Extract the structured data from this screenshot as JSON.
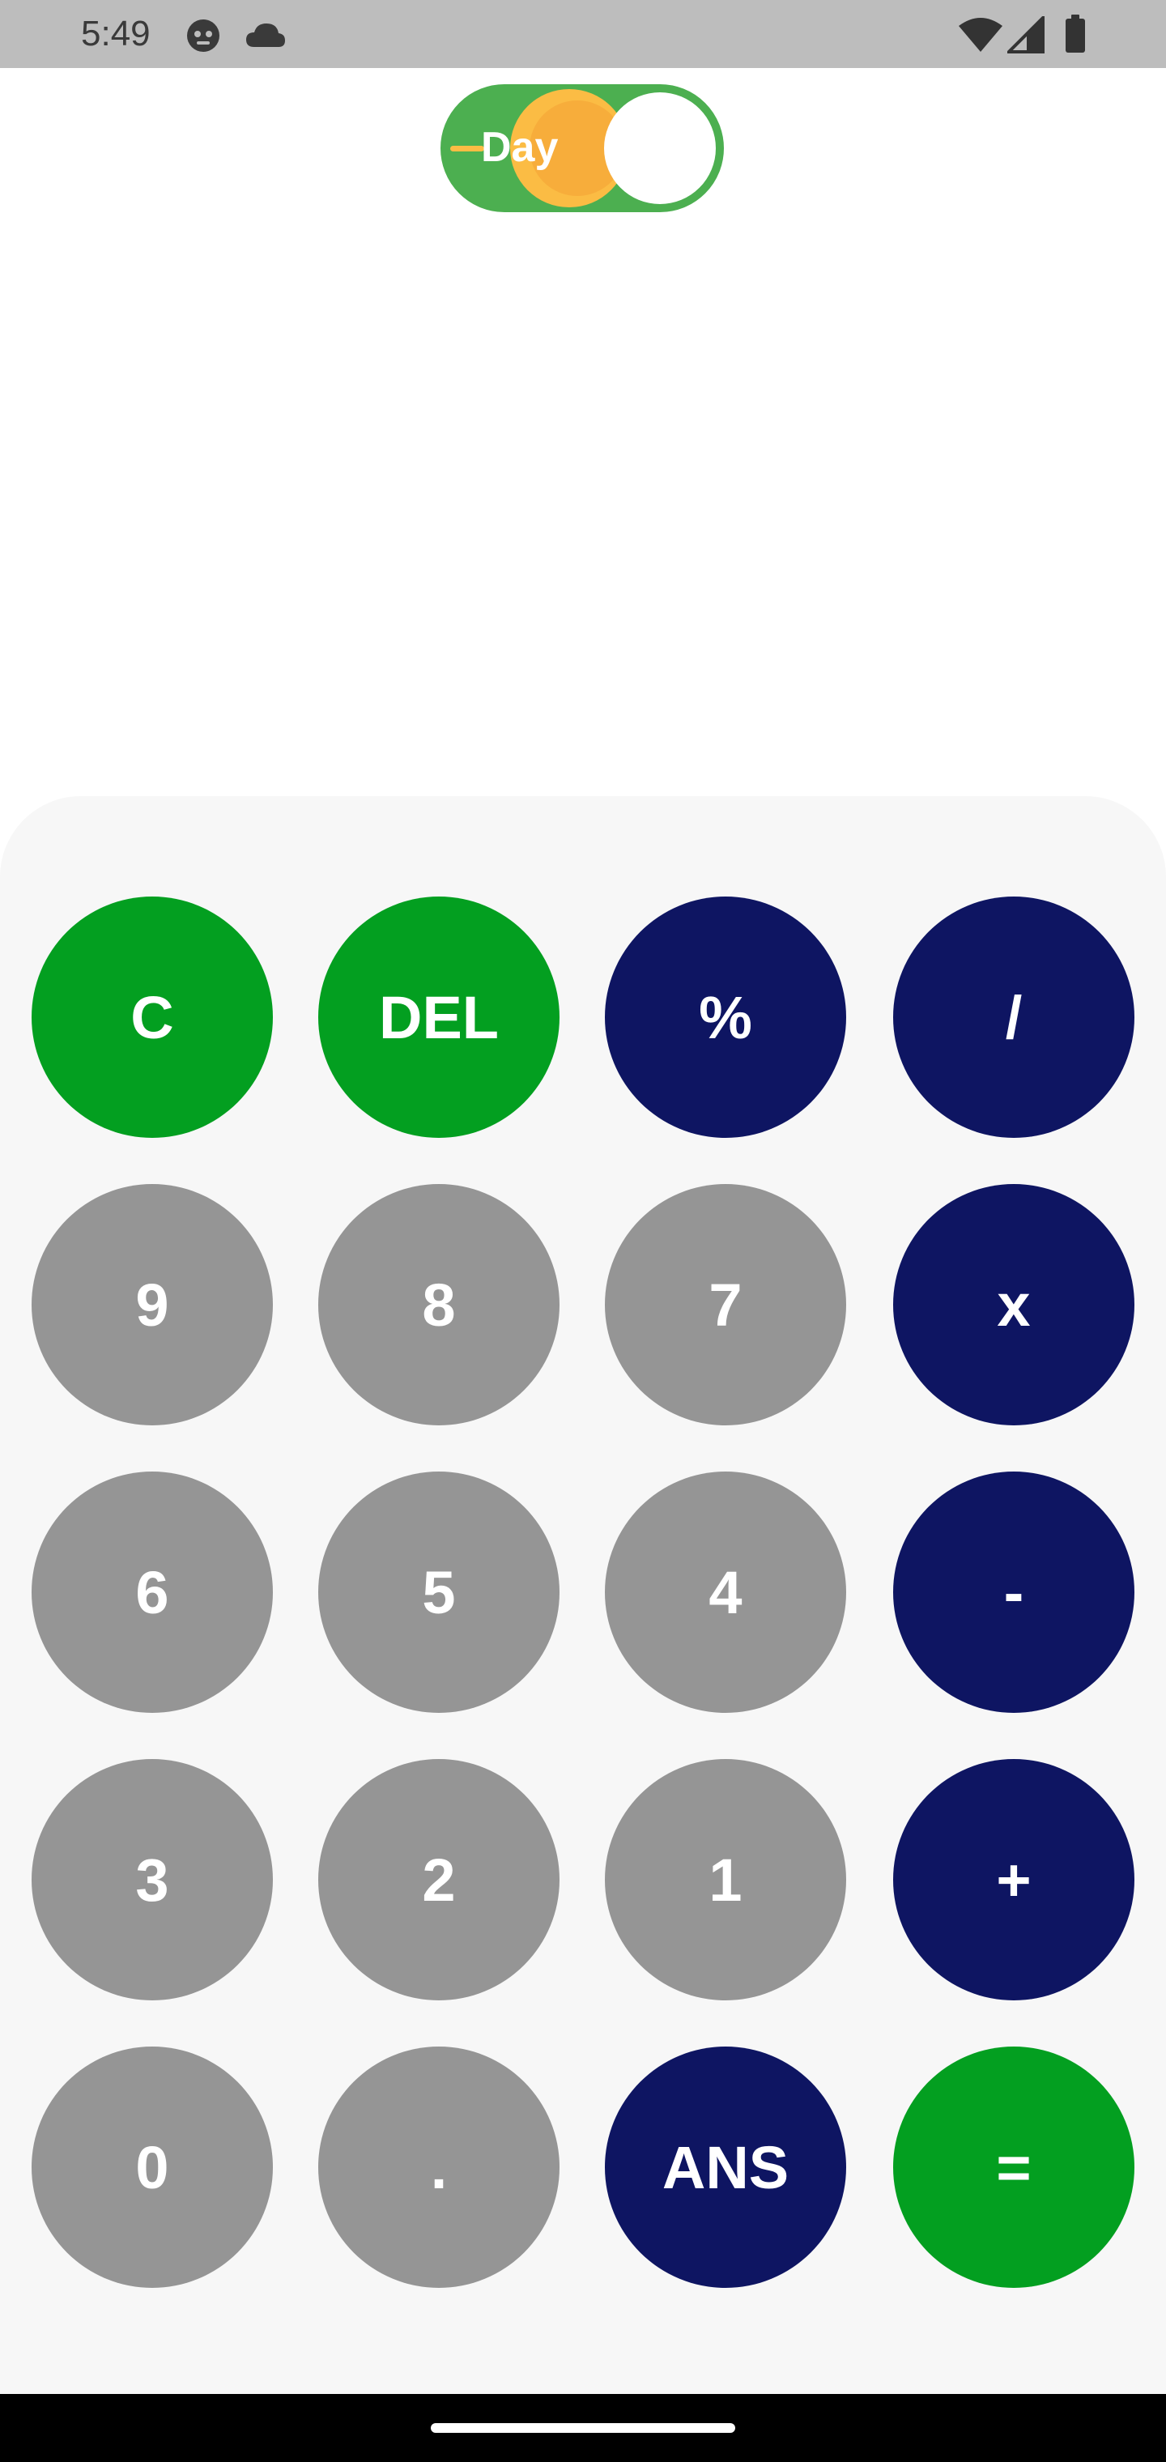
{
  "status_bar": {
    "time": "5:49",
    "icons": [
      "cat-face-icon",
      "cloud-icon",
      "wifi-icon",
      "cell-signal-icon",
      "battery-icon"
    ]
  },
  "theme_toggle": {
    "label": "Day",
    "state": "day"
  },
  "keypad": {
    "rows": [
      [
        {
          "label": "C",
          "kind": "green",
          "name": "clear-button"
        },
        {
          "label": "DEL",
          "kind": "green",
          "name": "delete-button"
        },
        {
          "label": "%",
          "kind": "navy",
          "name": "percent-button"
        },
        {
          "label": "/",
          "kind": "navy",
          "name": "divide-button"
        }
      ],
      [
        {
          "label": "9",
          "kind": "gray",
          "name": "digit-9-button"
        },
        {
          "label": "8",
          "kind": "gray",
          "name": "digit-8-button"
        },
        {
          "label": "7",
          "kind": "gray",
          "name": "digit-7-button"
        },
        {
          "label": "x",
          "kind": "navy",
          "name": "multiply-button"
        }
      ],
      [
        {
          "label": "6",
          "kind": "gray",
          "name": "digit-6-button"
        },
        {
          "label": "5",
          "kind": "gray",
          "name": "digit-5-button"
        },
        {
          "label": "4",
          "kind": "gray",
          "name": "digit-4-button"
        },
        {
          "label": "-",
          "kind": "navy",
          "name": "subtract-button"
        }
      ],
      [
        {
          "label": "3",
          "kind": "gray",
          "name": "digit-3-button"
        },
        {
          "label": "2",
          "kind": "gray",
          "name": "digit-2-button"
        },
        {
          "label": "1",
          "kind": "gray",
          "name": "digit-1-button"
        },
        {
          "label": "+",
          "kind": "navy",
          "name": "add-button"
        }
      ],
      [
        {
          "label": "0",
          "kind": "gray",
          "name": "digit-0-button"
        },
        {
          "label": ".",
          "kind": "gray",
          "name": "decimal-point-button"
        },
        {
          "label": "ANS",
          "kind": "navy",
          "name": "answer-button"
        },
        {
          "label": "=",
          "kind": "green",
          "name": "equals-button"
        }
      ]
    ]
  },
  "colors": {
    "green": "#039f20",
    "navy": "#0e1562",
    "gray": "#959595",
    "toggle_track": "#4caf50",
    "sun": "#fbbc44"
  }
}
